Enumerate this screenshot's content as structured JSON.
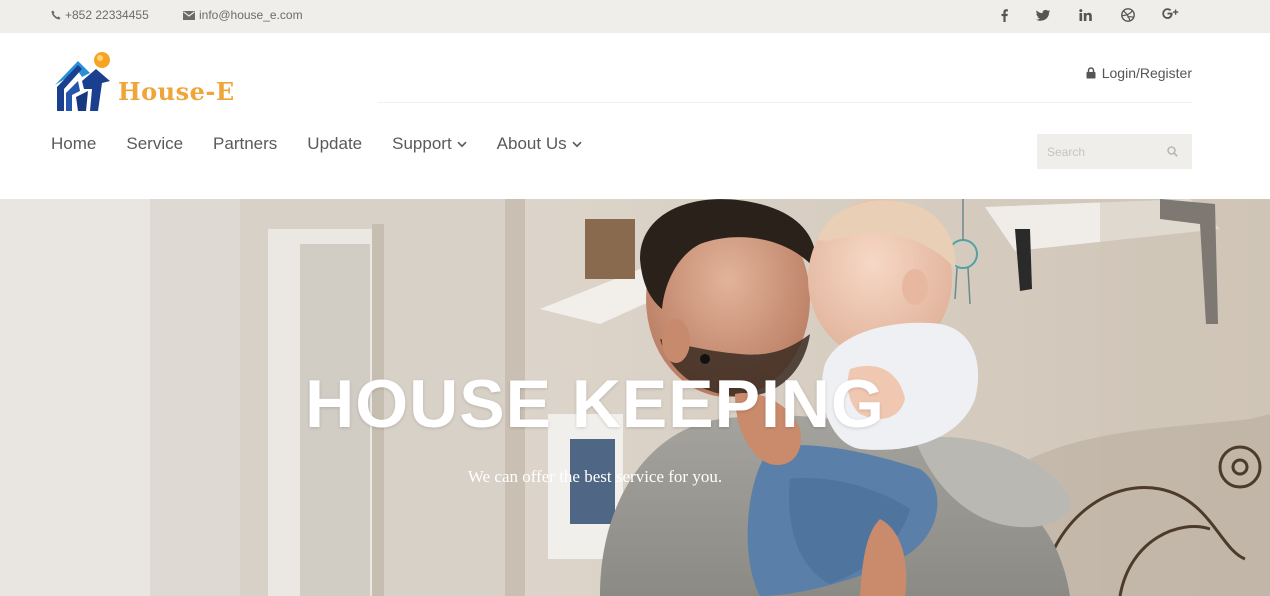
{
  "topbar": {
    "phone": "+852 22334455",
    "email": "info@house_e.com",
    "social": [
      "facebook-icon",
      "twitter-icon",
      "linkedin-icon",
      "dribbble-icon",
      "google-plus-icon"
    ]
  },
  "header": {
    "logo_text": "House-E",
    "login_label": "Login/Register",
    "search_placeholder": "Search"
  },
  "nav": {
    "items": [
      {
        "label": "Home",
        "has_dropdown": false
      },
      {
        "label": "Service",
        "has_dropdown": false
      },
      {
        "label": "Partners",
        "has_dropdown": false
      },
      {
        "label": "Update",
        "has_dropdown": false
      },
      {
        "label": "Support",
        "has_dropdown": true
      },
      {
        "label": "About Us",
        "has_dropdown": true
      }
    ]
  },
  "hero": {
    "title": "HOUSE KEEPING",
    "subtitle": "We can offer the best service for you."
  },
  "colors": {
    "topbar_bg": "#efeeea",
    "logo_accent": "#f0a53b",
    "logo_blue": "#1f4fa3",
    "text": "#555555"
  }
}
